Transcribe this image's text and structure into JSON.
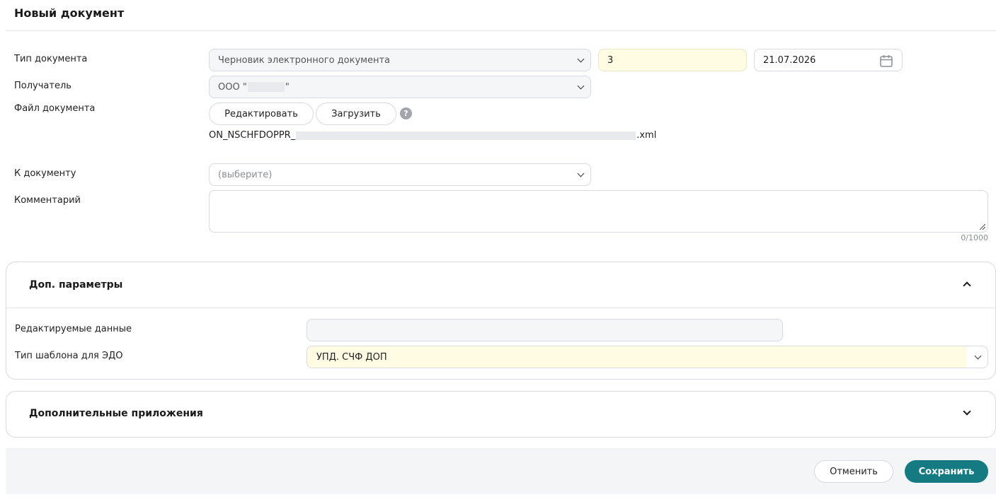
{
  "page": {
    "title": "Новый документ"
  },
  "form": {
    "doc_type": {
      "label": "Тип документа",
      "value": "Черновик электронного документа",
      "number": "3",
      "date": "21.07.2026"
    },
    "recipient": {
      "label": "Получатель",
      "value_prefix": "ООО \"",
      "value_suffix": "\""
    },
    "doc_file": {
      "label": "Файл документа",
      "edit_label": "Редактировать",
      "upload_label": "Загрузить",
      "help": "?",
      "filename_prefix": "ON_NSCHFDOPPR_",
      "filename_suffix": ".xml"
    },
    "to_document": {
      "label": "К документу",
      "placeholder": "(выберите)"
    },
    "comment": {
      "label": "Комментарий",
      "counter": "0/1000"
    }
  },
  "extra_params": {
    "title": "Доп. параметры",
    "editable_data_label": "Редактируемые данные",
    "template_type_label": "Тип шаблона для ЭДО",
    "template_type_value": "УПД. СЧФ ДОП"
  },
  "attachments": {
    "title": "Дополнительные приложения"
  },
  "footer": {
    "cancel_label": "Отменить",
    "save_label": "Сохранить"
  }
}
